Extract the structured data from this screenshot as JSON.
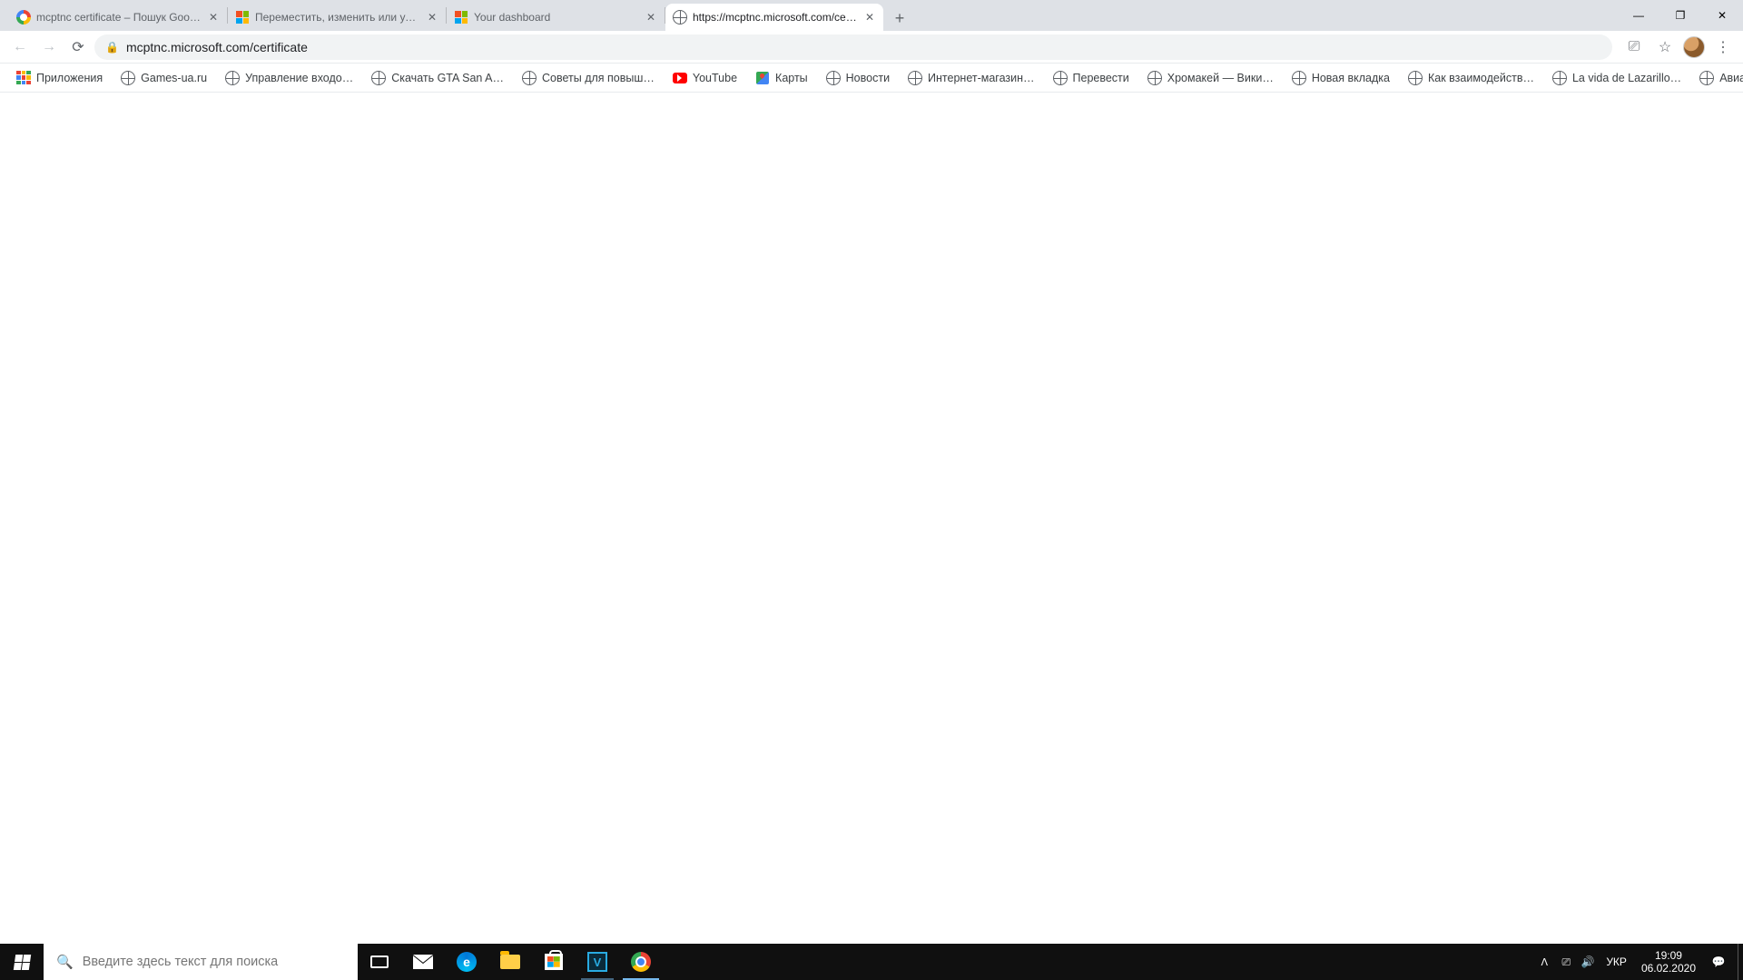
{
  "tabs": [
    {
      "title": "mcptnc certificate – Пошук Google",
      "favicon": "google"
    },
    {
      "title": "Переместить, изменить или удалить",
      "favicon": "ms"
    },
    {
      "title": "Your dashboard",
      "favicon": "ms"
    },
    {
      "title": "https://mcptnc.microsoft.com/certificate",
      "favicon": "globe",
      "active": true
    }
  ],
  "window": {
    "minimize": "—",
    "maximize": "❐",
    "close": "✕"
  },
  "address": {
    "url": "mcptnc.microsoft.com/certificate"
  },
  "bookmarks": [
    {
      "label": "Приложения",
      "icon": "apps"
    },
    {
      "label": "Games-ua.ru",
      "icon": "globe"
    },
    {
      "label": "Управление входо…",
      "icon": "globe"
    },
    {
      "label": "Скачать GTA San A…",
      "icon": "globe"
    },
    {
      "label": "Советы для повыш…",
      "icon": "globe"
    },
    {
      "label": "YouTube",
      "icon": "yt"
    },
    {
      "label": "Карты",
      "icon": "maps"
    },
    {
      "label": "Новости",
      "icon": "globe"
    },
    {
      "label": "Интернет-магазин…",
      "icon": "globe"
    },
    {
      "label": "Перевести",
      "icon": "globe"
    },
    {
      "label": "Хромакей — Вики…",
      "icon": "globe"
    },
    {
      "label": "Новая вкладка",
      "icon": "globe"
    },
    {
      "label": "Как взаимодейств…",
      "icon": "globe"
    },
    {
      "label": "La vida de Lazarillo…",
      "icon": "globe"
    },
    {
      "label": "Авиабилеты",
      "icon": "globe"
    }
  ],
  "taskbar": {
    "search_placeholder": "Введите здесь текст для поиска",
    "lang": "УКР",
    "time": "19:09",
    "date": "06.02.2020"
  }
}
